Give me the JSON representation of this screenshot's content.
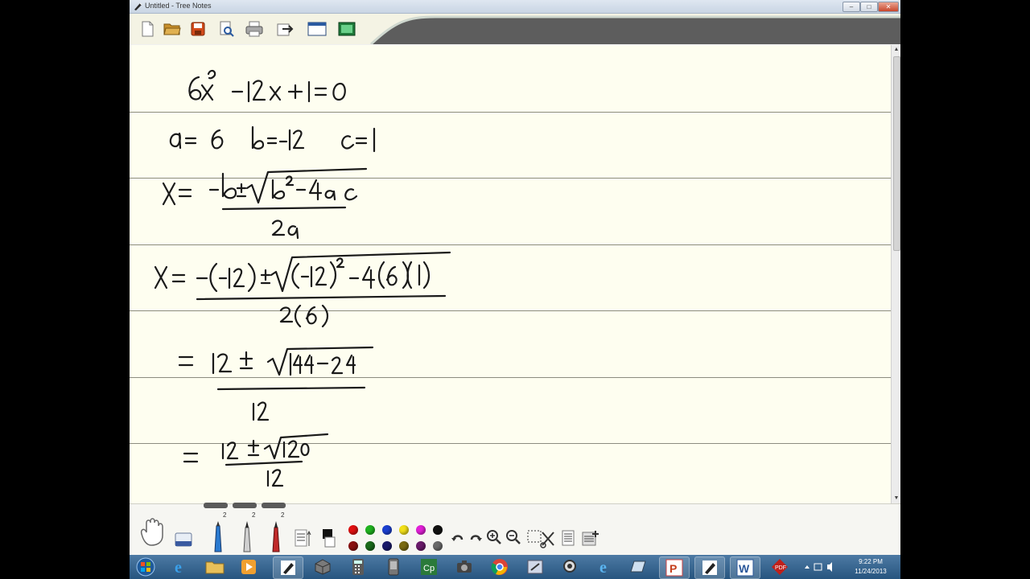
{
  "window": {
    "title": "Untitled - Tree Notes",
    "buttons": {
      "minimize": "–",
      "maximize": "□",
      "close": "✕"
    }
  },
  "toolbar": {
    "icons": [
      "new-page-icon",
      "open-folder-icon",
      "save-icon",
      "print-preview-icon",
      "print-icon",
      "export-icon",
      "window-icon",
      "screenshot-icon"
    ]
  },
  "palette": {
    "pen_sizes": [
      "2",
      "2",
      "2"
    ],
    "colors_top": [
      "#e01010",
      "#1fb31f",
      "#1a3fd0",
      "#f2e018",
      "#e21fd8",
      "#111111"
    ],
    "colors_bottom": [
      "#8a1010",
      "#1a6a1a",
      "#1a1a6a",
      "#7a6a10",
      "#6a1a6a",
      "#6a6a6a"
    ]
  },
  "notes": {
    "lines": [
      "6x² − 12x + 1 = 0",
      "a = 6   b = −12   c = 1",
      "x = −b ± √(b² − 4ac) / 2a",
      "x = −(−12) ± √((−12)² − 4(6)(1)) / 2(6)",
      "= 12 ± √(144 − 24) / 12",
      "= 12 ± √120 / 12"
    ]
  },
  "taskbar": {
    "time": "9:22 PM",
    "date": "11/24/2013"
  }
}
